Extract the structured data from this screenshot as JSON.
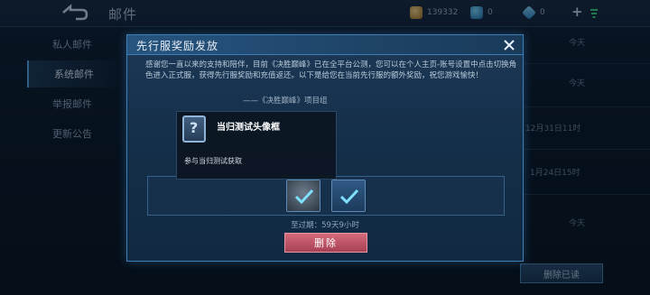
{
  "topbar": {
    "title": "邮件",
    "gold": "139332",
    "coupons": "0",
    "gems": "0",
    "plus": "+"
  },
  "sidebar": {
    "items": [
      {
        "label": "私人邮件"
      },
      {
        "label": "系统邮件"
      },
      {
        "label": "举报邮件"
      },
      {
        "label": "更新公告"
      }
    ]
  },
  "mail_list": {
    "dates": [
      "今天",
      "今天",
      "12月31日11时",
      "1月24日15时",
      "今天"
    ],
    "delete_read_label": "删除已读"
  },
  "modal": {
    "title": "先行服奖励发放",
    "body": "感谢您一直以来的支持和陪伴，目前《决胜巅峰》已在全平台公测，您可以在个人主页-账号设置中点击切换角色进入正式服，获得先行服奖励和充值返还。以下是给您在当前先行服的额外奖励，祝您游戏愉快！",
    "signature": "——《决胜巅峰》项目组",
    "expire": "至过期：59天9小时",
    "delete_label": "删除"
  },
  "tooltip": {
    "name": "当归测试头像框",
    "desc": "参与当归测试获取"
  },
  "colors": {
    "accent": "#3e7fb8",
    "delete_button": "#c25466",
    "check": "#7fe0ff"
  }
}
